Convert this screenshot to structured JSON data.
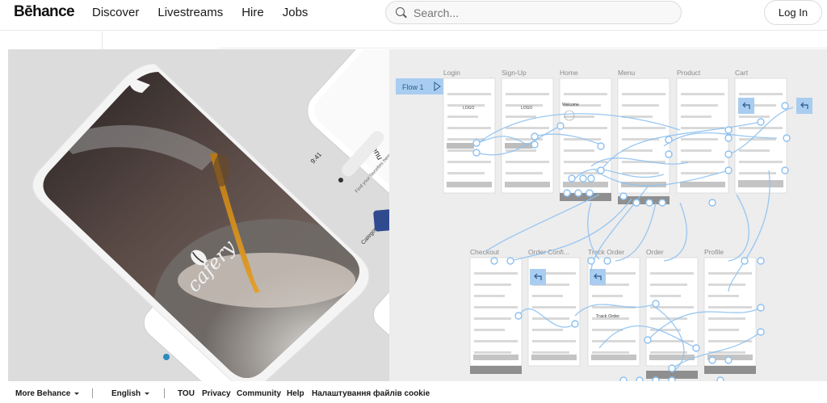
{
  "header": {
    "logo": "Bēhance",
    "nav": [
      "Discover",
      "Livestreams",
      "Hire",
      "Jobs"
    ],
    "search_placeholder": "Search...",
    "login_label": "Log In"
  },
  "left_image": {
    "brand_text": "cafery",
    "time": "9:41",
    "menu_title": "Menu",
    "search_hint": "Find your favorites here",
    "category_label": "Category"
  },
  "flow": {
    "flow_label": "Flow 1",
    "row1": [
      "Login",
      "Sign-Up",
      "Home",
      "Menu",
      "Product",
      "Cart"
    ],
    "row2": [
      "Checkout",
      "Order Confi...",
      "Track Order",
      "Order",
      "Profile"
    ],
    "logo_text": "LOGO",
    "welcome": "Welcome",
    "track_order_text": "Track Order"
  },
  "footer": {
    "more_behance": "More Behance",
    "language": "English",
    "links": [
      "TOU",
      "Privacy",
      "Community",
      "Help",
      "Налаштування файлів cookie"
    ]
  },
  "colors": {
    "accent_blue": "#a8cdf0",
    "flow_blue": "#8ec1ef",
    "coffee_dark": "#2a2220"
  }
}
